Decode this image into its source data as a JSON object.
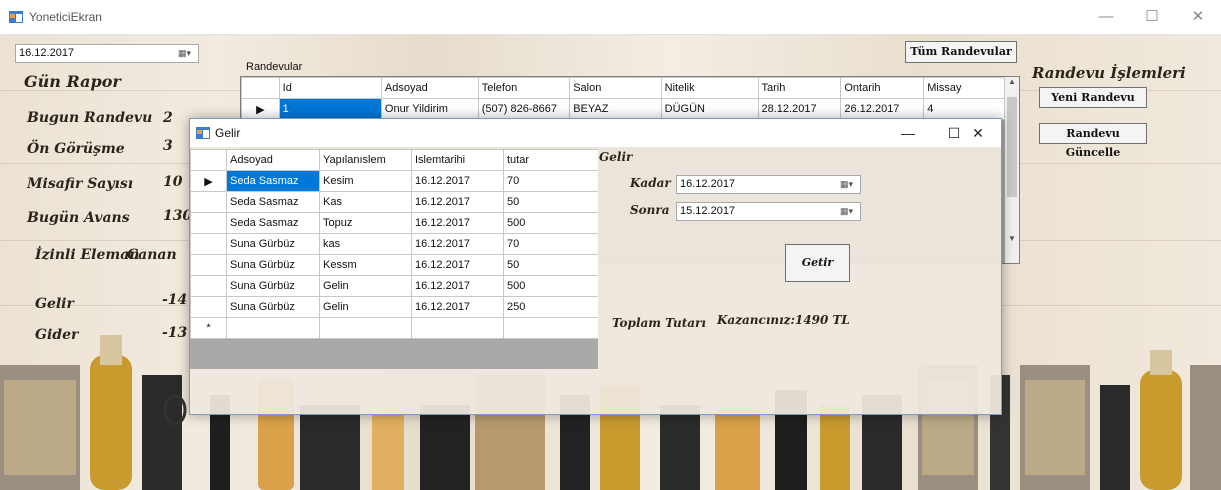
{
  "main_window": {
    "title": "YoneticiEkran",
    "controls": {
      "minimize": "—",
      "maximize": "☐",
      "close": "✕"
    }
  },
  "date_picker": {
    "value": "16.12.2017"
  },
  "gun_rapor": {
    "title": "Gün Rapor",
    "rows": [
      {
        "label": "Bugun Randevu",
        "value": "2"
      },
      {
        "label": "Ön Görüşme",
        "value": "3"
      },
      {
        "label": "Misafir Sayısı",
        "value": "10"
      },
      {
        "label": "Bugün Avans",
        "value": "130"
      },
      {
        "label": "İzinli Eleman",
        "value": "Canan"
      },
      {
        "label": "Gelir",
        "value": "-14"
      },
      {
        "label": "Gider",
        "value": "-13"
      }
    ]
  },
  "randevular": {
    "label": "Randevular",
    "all_button": "Tüm Randevular",
    "columns": [
      "Id",
      "Adsoyad",
      "Telefon",
      "Salon",
      "Nitelik",
      "Tarih",
      "Ontarih",
      "Missay"
    ],
    "rows": [
      [
        "1",
        "Onur Yildirim",
        "(507) 826-8667",
        "BEYAZ",
        "DÜGÜN",
        "28.12.2017",
        "26.12.2017",
        "4"
      ]
    ]
  },
  "randevu_islemleri": {
    "title": "Randevu İşlemleri",
    "new_button": "Yeni Randevu",
    "update_button": "Randevu Güncelle"
  },
  "gelir_dialog": {
    "title": "Gelir",
    "controls": {
      "minimize": "—",
      "maximize": "☐",
      "close": "✕"
    },
    "grid": {
      "columns": [
        "Adsoyad",
        "Yapılanıslem",
        "Islemtarihi",
        "tutar"
      ],
      "rows": [
        [
          "Seda Sasmaz",
          "Kesim",
          "16.12.2017",
          "70"
        ],
        [
          "Seda Sasmaz",
          "Kas",
          "16.12.2017",
          "50"
        ],
        [
          "Seda Sasmaz",
          "Topuz",
          "16.12.2017",
          "500"
        ],
        [
          "Suna Gürbüz",
          "kas",
          "16.12.2017",
          "70"
        ],
        [
          "Suna Gürbüz",
          "Kessm",
          "16.12.2017",
          "50"
        ],
        [
          "Suna Gürbüz",
          "Gelin",
          "16.12.2017",
          "500"
        ],
        [
          "Suna Gürbüz",
          "Gelin",
          "16.12.2017",
          "250"
        ]
      ],
      "new_row_marker": "*"
    },
    "group_label": "Gelir",
    "kadar_label": "Kadar",
    "kadar_value": "16.12.2017",
    "sonra_label": "Sonra",
    "sonra_value": "15.12.2017",
    "getir_button": "Getir",
    "toplam_label": "Toplam Tutarı",
    "kazanc_text": "Kazancınız:1490 TL"
  },
  "colors": {
    "selection": "#0078d7",
    "dialog_border": "#7a9cc6"
  },
  "icons": [
    "app-icon",
    "calendar-dropdown-icon",
    "row-arrow-icon",
    "scroll-up-icon",
    "scroll-down-icon"
  ]
}
